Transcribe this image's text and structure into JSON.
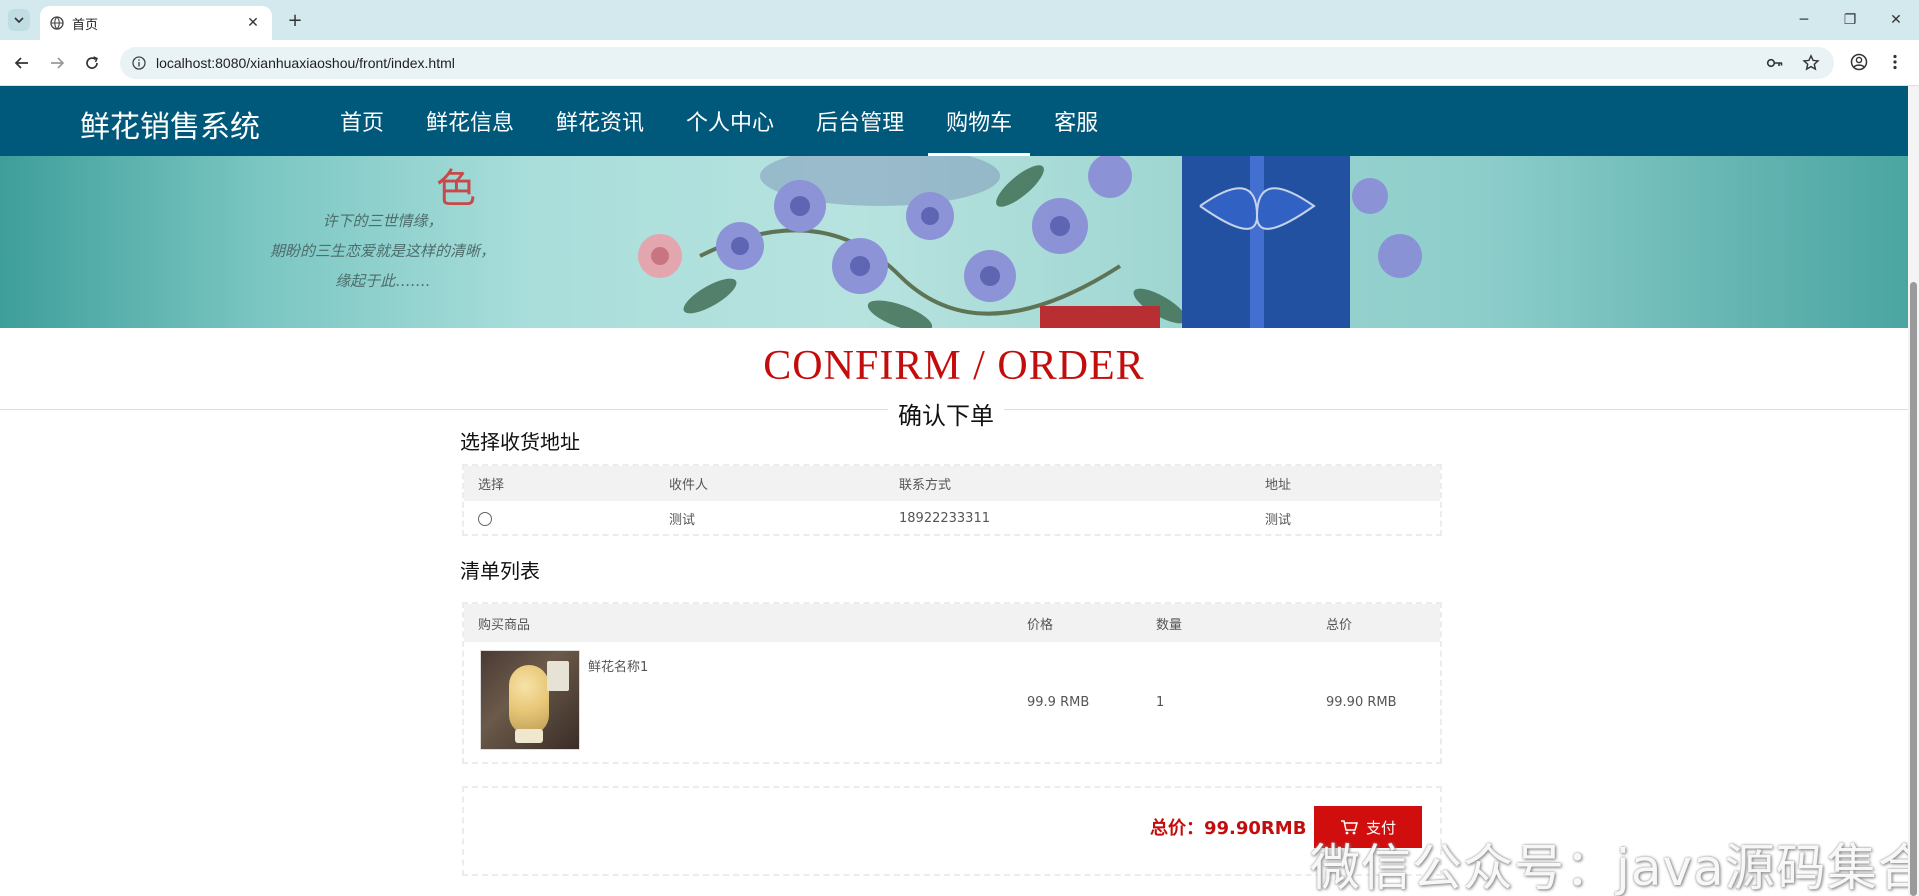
{
  "browser": {
    "tab_title": "首页",
    "tab_close": "✕",
    "new_tab": "+",
    "url": "localhost:8080/xianhuaxiaoshou/front/index.html",
    "window_controls": {
      "minimize": "─",
      "restore": "❐",
      "close": "✕"
    }
  },
  "site": {
    "logo": "鲜花销售系统",
    "menu": [
      {
        "label": "首页",
        "active": false
      },
      {
        "label": "鲜花信息",
        "active": false
      },
      {
        "label": "鲜花资讯",
        "active": false
      },
      {
        "label": "个人中心",
        "active": false
      },
      {
        "label": "后台管理",
        "active": false
      },
      {
        "label": "购物车",
        "active": true
      },
      {
        "label": "客服",
        "active": false
      }
    ]
  },
  "banner": {
    "poem_lines": [
      "许下的三世情缘，",
      "期盼的三生恋爱就是这样的清晰，",
      "缘起于此……."
    ],
    "red_char": "色"
  },
  "heading": {
    "en": "CONFIRM / ORDER",
    "cn": "确认下单"
  },
  "address_section": {
    "title": "选择收货地址",
    "columns": [
      "选择",
      "收件人",
      "联系方式",
      "地址"
    ],
    "rows": [
      {
        "recipient": "测试",
        "phone": "18922233311",
        "address": "测试"
      }
    ]
  },
  "items_section": {
    "title": "清单列表",
    "columns": [
      "购买商品",
      "价格",
      "数量",
      "总价"
    ],
    "rows": [
      {
        "name": "鲜花名称1",
        "price": "99.9 RMB",
        "quantity": "1",
        "total": "99.90 RMB"
      }
    ]
  },
  "summary": {
    "total_label": "总价：99.90RMB",
    "pay_button": "支付"
  },
  "watermark": "微信公众号：java源码集合",
  "colors": {
    "nav_bg": "#00587a",
    "accent_red": "#c30d0d",
    "pay_button": "#d10e0e",
    "tabbar_bg": "#d3e9ee"
  }
}
